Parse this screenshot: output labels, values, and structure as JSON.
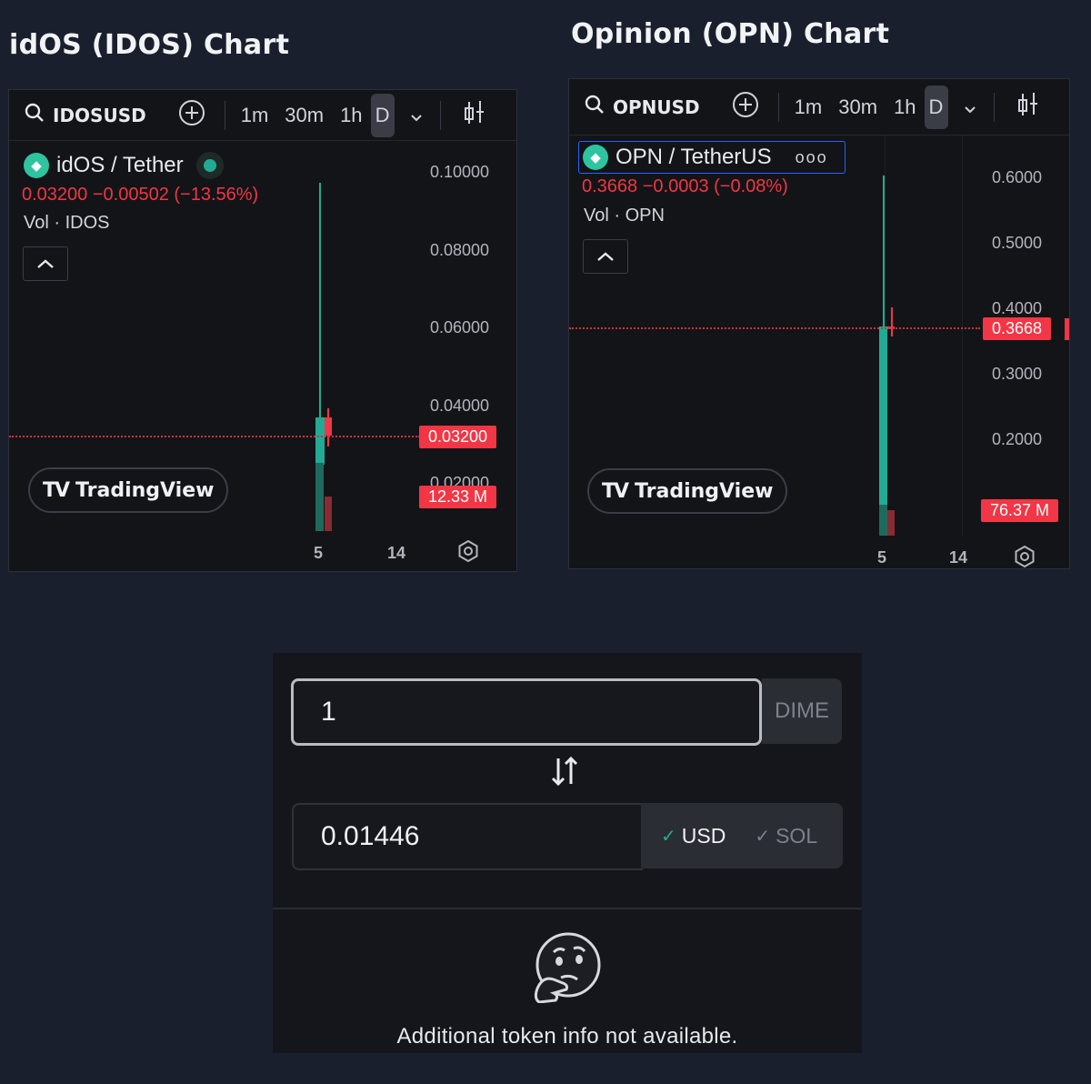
{
  "idos": {
    "title": "idOS (IDOS) Chart",
    "symbol": "IDOSUSD",
    "timeframes": [
      "1m",
      "30m",
      "1h",
      "D"
    ],
    "pair": "idOS / Tether",
    "price_line": "0.03200  −0.00502 (−13.56%)",
    "volume_label": "Vol · IDOS",
    "axis": [
      "0.10000",
      "0.08000",
      "0.06000",
      "0.04000",
      "0.02000"
    ],
    "price_tag": "0.03200",
    "volume_tag": "12.33 M",
    "dates": [
      "5",
      "14"
    ],
    "brand": "TradingView"
  },
  "opn": {
    "title": "Opinion (OPN) Chart",
    "symbol": "OPNUSD",
    "timeframes": [
      "1m",
      "30m",
      "1h",
      "D"
    ],
    "pair": "OPN / TetherUS",
    "price_line": "0.3668  −0.0003 (−0.08%)",
    "volume_label": "Vol · OPN",
    "axis": [
      "0.6000",
      "0.5000",
      "0.4000",
      "0.3000",
      "0.2000"
    ],
    "price_tag": "0.3668",
    "volume_tag": "76.37 M",
    "dates": [
      "5",
      "14"
    ],
    "brand": "TradingView"
  },
  "converter": {
    "amount": "1",
    "amount_unit": "DIME",
    "result": "0.01446",
    "currencies": [
      "USD",
      "SOL"
    ],
    "selected_currency": "USD",
    "no_info": "Additional token info not available."
  },
  "colors": {
    "up": "#22ab94",
    "down": "#f23645",
    "background": "#1a1f2e"
  }
}
